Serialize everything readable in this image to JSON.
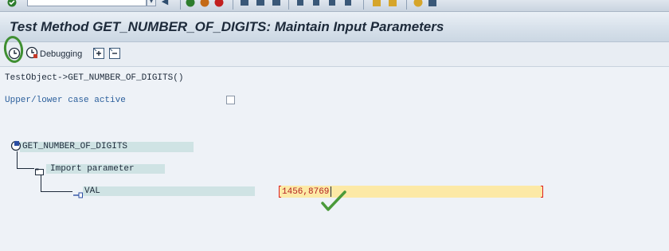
{
  "window": {
    "title": "Test Method GET_NUMBER_OF_DIGITS: Maintain Input Parameters"
  },
  "toolbar": {
    "debugging_label": "Debugging",
    "icons": [
      "enter-icon",
      "command-field",
      "back-icon",
      "exit-icon",
      "cancel-icon",
      "save-icon",
      "print-icon",
      "find-icon",
      "find-next-icon",
      "first-page-icon",
      "previous-page-icon",
      "next-page-icon",
      "last-page-icon",
      "create-session-icon",
      "shortcut-icon",
      "help-icon"
    ]
  },
  "app_toolbar": {
    "execute": "execute-icon",
    "debugging": "debugging-icon",
    "expand": "expand-all-icon",
    "collapse": "collapse-all-icon"
  },
  "content": {
    "object_path": "TestObject->GET_NUMBER_OF_DIGITS()",
    "case_label": "Upper/lower case active",
    "case_checked": false,
    "tree": {
      "method": "GET_NUMBER_OF_DIGITS",
      "import_label": "Import parameter",
      "param_name": "VAL",
      "param_value": "1456,8769"
    }
  },
  "colors": {
    "accent_green": "#3f8f32",
    "input_bg": "#fce9a6",
    "value_text": "#b32121",
    "tree_highlight": "#cfe3e4"
  }
}
